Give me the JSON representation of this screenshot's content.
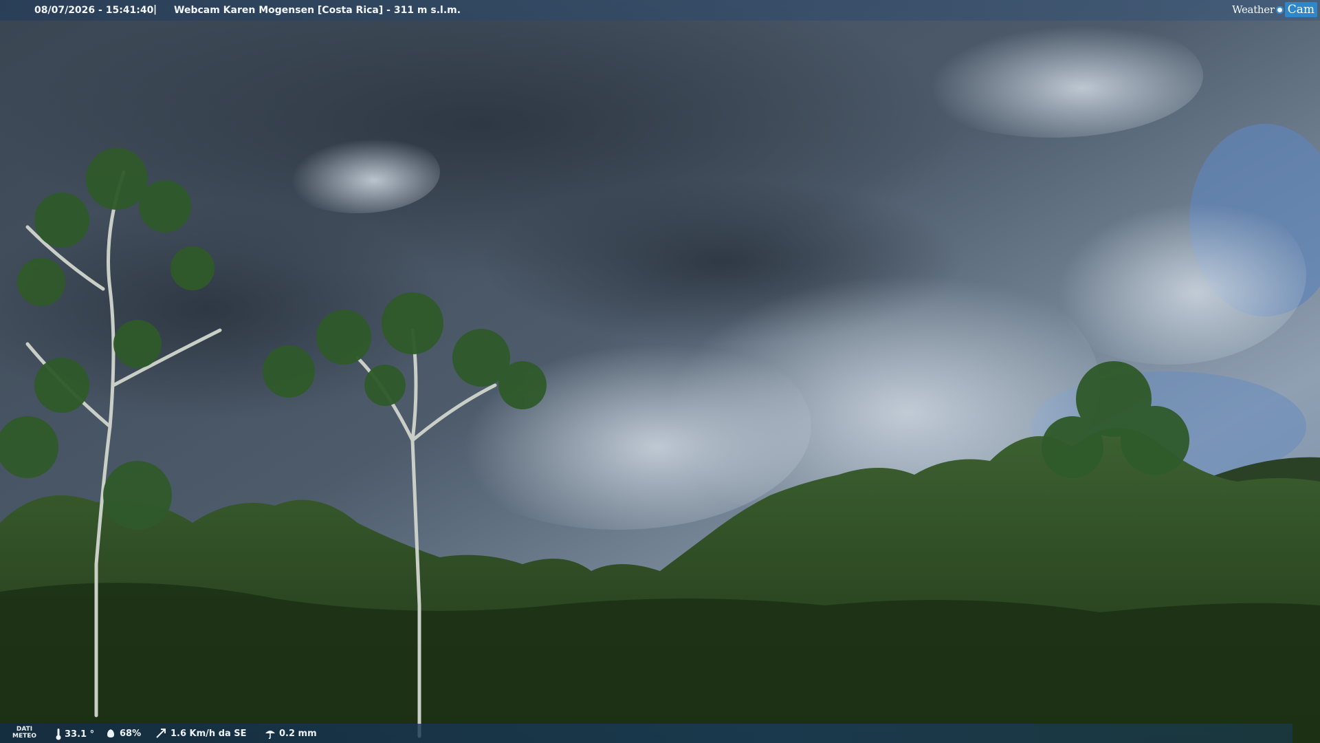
{
  "header": {
    "datetime": "08/07/2026 - 15:41:40",
    "separator": "|",
    "title": "Webcam Karen Mogensen [Costa Rica]  - 311 m s.l.m."
  },
  "logo": {
    "word1": "Weather",
    "word2": "Cam"
  },
  "weather": {
    "label_line1": "DATI",
    "label_line2": "METEO",
    "temperature": "33.1 °",
    "humidity": "68%",
    "wind": "1.6 Km/h da SE",
    "rain": "0.2 mm"
  },
  "colors": {
    "sky": "#4a5868",
    "foliage": "#2c4a22",
    "accent": "#2f86c8"
  },
  "icons": [
    "thermometer-icon",
    "humidity-icon",
    "wind-icon",
    "rain-icon"
  ]
}
